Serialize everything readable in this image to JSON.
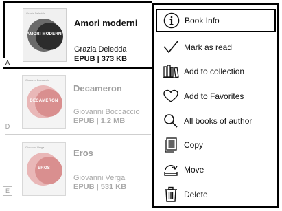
{
  "books": [
    {
      "letter": "A",
      "title": "Amori moderni",
      "author": "Grazia Deledda",
      "meta": "EPUB | 373 KB",
      "cover_text": "AMORI MODERNI",
      "cover_author": "Grazia Deledda",
      "state": "active"
    },
    {
      "letter": "D",
      "title": "Decameron",
      "author": "Giovanni Boccaccio",
      "meta": "EPUB | 1.2 MB",
      "cover_text": "DECAMERON",
      "cover_author": "Giovanni Boccaccio",
      "state": "dim"
    },
    {
      "letter": "E",
      "title": "Eros",
      "author": "Giovanni Verga",
      "meta": "EPUB | 531 KB",
      "cover_text": "EROS",
      "cover_author": "Giovanni Verga",
      "state": "dim"
    }
  ],
  "menu": {
    "items": [
      {
        "label": "Book Info",
        "icon": "info-icon"
      },
      {
        "label": "Mark as read",
        "icon": "checkmark-icon"
      },
      {
        "label": "Add to collection",
        "icon": "bookshelf-icon"
      },
      {
        "label": "Add to Favorites",
        "icon": "heart-icon"
      },
      {
        "label": "All books of author",
        "icon": "search-icon"
      },
      {
        "label": "Copy",
        "icon": "copy-icon"
      },
      {
        "label": "Move",
        "icon": "move-icon"
      },
      {
        "label": "Delete",
        "icon": "trash-icon"
      }
    ],
    "selected_index": 0
  }
}
